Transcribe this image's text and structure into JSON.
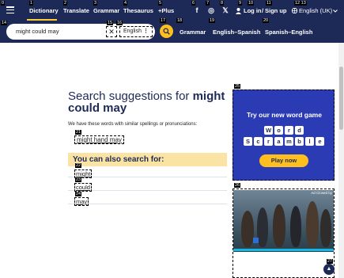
{
  "nav": {
    "items": [
      {
        "label": "Dictionary",
        "tag": "1"
      },
      {
        "label": "Translate",
        "tag": "2"
      },
      {
        "label": "Grammar",
        "tag": "3"
      },
      {
        "label": "Thesaurus",
        "tag": "4"
      },
      {
        "label": "+Plus",
        "tag": "5"
      }
    ],
    "menu_tag": "0",
    "social": [
      {
        "icon": "facebook-icon",
        "glyph": "f",
        "tag": "6"
      },
      {
        "icon": "instagram-icon",
        "glyph": "◎",
        "tag": "7"
      },
      {
        "icon": "x-twitter-icon",
        "glyph": "𝕏",
        "tag": "8"
      }
    ],
    "login": "Log in",
    "login_tag": "9",
    "login_tag2": "10",
    "separator": "/",
    "signup": "Sign up",
    "signup_tag": "11",
    "language": "English (UK)",
    "language_tags": "12 13"
  },
  "search": {
    "value": "might could may",
    "field_tag": "14",
    "clear_tag": "15",
    "lang_tag": "16",
    "lang": "English",
    "button_tag": "17",
    "links": [
      {
        "label": "Grammar",
        "tag": "18"
      },
      {
        "label": "English–Spanish",
        "tag": "19"
      },
      {
        "label": "Spanish–English",
        "tag": "20"
      }
    ]
  },
  "main": {
    "heading_prefix": "Search suggestions for ",
    "heading_term": "might could may",
    "intro": "We have these words with similar spellings or pronunciations:",
    "suggestion": "might hand may",
    "suggestion_tag": "21",
    "also_title": "You can also search for:",
    "alternatives": [
      {
        "label": "might",
        "tag": "22"
      },
      {
        "label": "could",
        "tag": "23"
      },
      {
        "label": "may",
        "tag": "24"
      }
    ]
  },
  "ad1": {
    "tag": "25",
    "title": "Try our new word game",
    "word1": [
      "W",
      "o",
      "r",
      "d"
    ],
    "word2": [
      "S",
      "c",
      "r",
      "a",
      "m",
      "b",
      "l",
      "e"
    ],
    "button": "Play now"
  },
  "ad2": {
    "tag": "26",
    "badge": "Ad Closed by"
  },
  "scroll_top_tag": "27",
  "colors": {
    "navy": "#1d2a57",
    "accent": "#ffc01f",
    "highlight": "#fbe3a4",
    "ad_blue": "#2b3bb4"
  }
}
